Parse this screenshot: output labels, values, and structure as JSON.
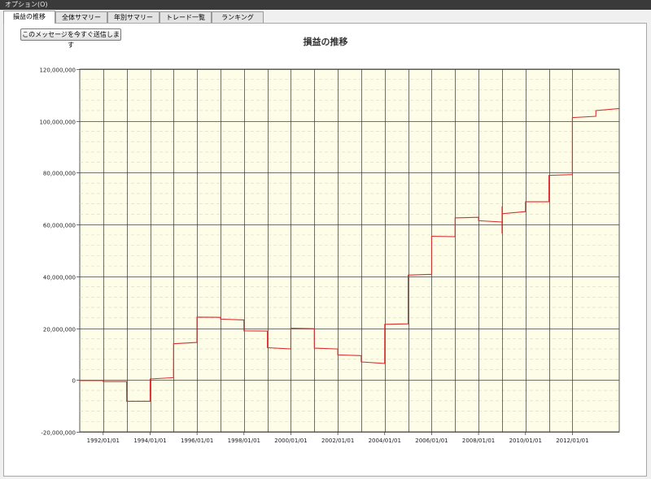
{
  "menu": {
    "options_label": "オプション(O)"
  },
  "tabs": [
    {
      "label": "損益の推移",
      "active": true
    },
    {
      "label": "全体サマリー",
      "active": false
    },
    {
      "label": "年別サマリー",
      "active": false
    },
    {
      "label": "トレード一覧",
      "active": false
    },
    {
      "label": "ランキング",
      "active": false
    }
  ],
  "toolbar": {
    "send_button_label": "このメッセージを今すぐ送信します"
  },
  "colors": {
    "plot_background": "#fefde8",
    "series_line": "#d83030",
    "major_grid": "#444444",
    "minor_grid": "#d8d8c0"
  },
  "chart_data": {
    "type": "line",
    "title": "損益の推移",
    "xlabel": "",
    "ylabel": "",
    "xlim": [
      "1991/01/01",
      "2013/12/31"
    ],
    "ylim": [
      -20000000,
      120000000
    ],
    "y_ticks": [
      -20000000,
      0,
      20000000,
      40000000,
      60000000,
      80000000,
      100000000,
      120000000
    ],
    "y_tick_labels": [
      "-20,000,000",
      "0",
      "20,000,000",
      "40,000,000",
      "60,000,000",
      "80,000,000",
      "100,000,000",
      "120,000,000"
    ],
    "x_ticks": [
      "1992/01/01",
      "1994/01/01",
      "1996/01/01",
      "1998/01/01",
      "2000/01/01",
      "2002/01/01",
      "2004/01/01",
      "2006/01/01",
      "2008/01/01",
      "2010/01/01",
      "2012/01/01"
    ],
    "x_tick_labels": [
      "1992/01/01",
      "1994/01/01",
      "1996/01/01",
      "1998/01/01",
      "2000/01/01",
      "2002/01/01",
      "2004/01/01",
      "2006/01/01",
      "2008/01/01",
      "2010/01/01",
      "2012/01/01"
    ],
    "vertical_grid": [
      "1992/01/01",
      "1993/01/01",
      "1994/01/01",
      "1995/01/01",
      "1996/01/01",
      "1997/01/01",
      "1998/01/01",
      "1999/01/01",
      "2000/01/01",
      "2001/01/01",
      "2002/01/01",
      "2003/01/01",
      "2004/01/01",
      "2005/01/01",
      "2006/01/01",
      "2007/01/01",
      "2008/01/01",
      "2009/01/01",
      "2010/01/01",
      "2011/01/01",
      "2012/01/01"
    ],
    "grid": true,
    "legend": "none",
    "series": [
      {
        "x": [
          "1991/01/01",
          "1991/12/31",
          "1992/01/01",
          "1992/12/31",
          "1993/01/01",
          "1993/12/31",
          "1994/01/01",
          "1994/12/31",
          "1995/01/01",
          "1995/12/31",
          "1996/01/01",
          "1996/12/31",
          "1997/01/01",
          "1997/12/31",
          "1998/01/01",
          "1998/12/31",
          "1999/01/01",
          "1999/12/31",
          "2000/01/01",
          "2000/12/31",
          "2001/01/01",
          "2001/12/31",
          "2002/01/01",
          "2002/12/31",
          "2003/01/01",
          "2003/12/31",
          "2004/01/01",
          "2004/12/31",
          "2005/01/01",
          "2005/12/31",
          "2006/01/01",
          "2006/12/31",
          "2007/01/01",
          "2007/12/31",
          "2008/01/01",
          "2008/12/31",
          "2009/01/01",
          "2009/01/01",
          "2009/01/01",
          "2009/12/31",
          "2010/01/01",
          "2010/12/31",
          "2011/01/01",
          "2011/12/31",
          "2012/01/01",
          "2012/12/31",
          "2013/01/01",
          "2013/12/31"
        ],
        "y": [
          -200000,
          -200000,
          -600000,
          -600000,
          -8200000,
          -8200000,
          400000,
          900000,
          14000000,
          14500000,
          24300000,
          24200000,
          23500000,
          23200000,
          19000000,
          18900000,
          12500000,
          12000000,
          20000000,
          19800000,
          12300000,
          12000000,
          9700000,
          9400000,
          7000000,
          6400000,
          21500000,
          21700000,
          40500000,
          40800000,
          55500000,
          55300000,
          62600000,
          62800000,
          61500000,
          61000000,
          56500000,
          67000000,
          64200000,
          65000000,
          68800000,
          68800000,
          79000000,
          79300000,
          101300000,
          101800000,
          104000000,
          104800000
        ]
      }
    ]
  }
}
